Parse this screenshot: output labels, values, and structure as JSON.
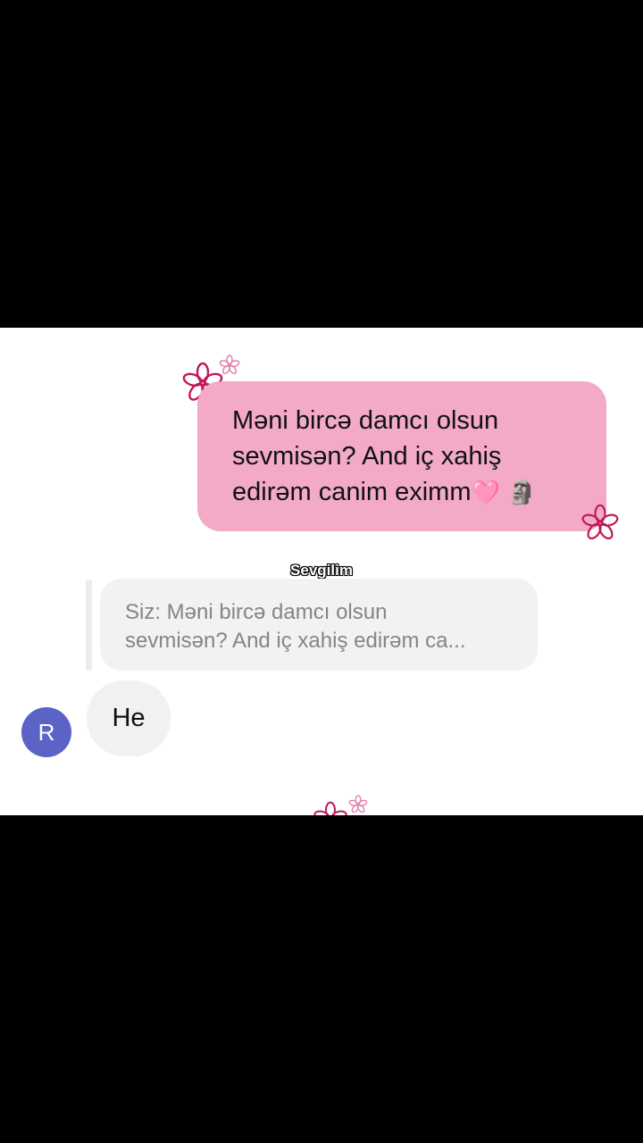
{
  "conversation": {
    "sent_message": {
      "text": "Məni bircə damcı olsun sevmisən? And iç xahiş edirəm canim eximm",
      "emoji_heart": "🩷",
      "emoji_moai": "🗿"
    },
    "sender_name": "Sevgilim",
    "reply_preview": {
      "text": "Siz: Məni bircə damcı olsun\nsevmisən? And iç xahiş edirəm ca..."
    },
    "received_message": {
      "text": "He"
    },
    "avatar": {
      "initial": "R",
      "color": "#5b63c6"
    }
  },
  "colors": {
    "sent_bubble": "#f2aac6",
    "received_bubble": "#f1f1f3",
    "flower_stroke": "#c2185b",
    "background": "#ffffff",
    "letterbox": "#000000"
  }
}
